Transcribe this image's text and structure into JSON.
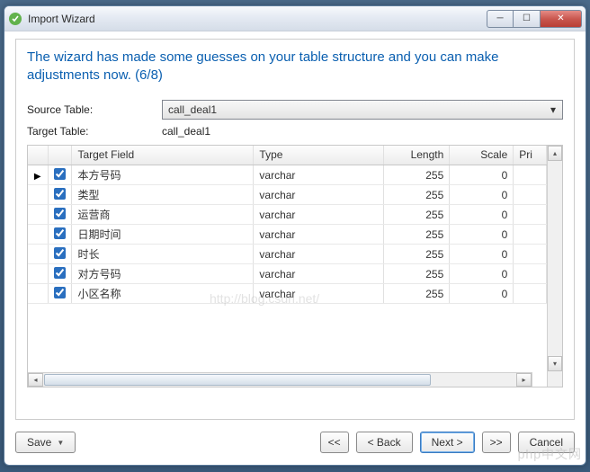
{
  "window": {
    "title": "Import Wizard"
  },
  "heading": "The wizard has made some guesses on your table structure and you can make adjustments now. (6/8)",
  "form": {
    "source_label": "Source Table:",
    "source_value": "call_deal1",
    "target_label": "Target Table:",
    "target_value": "call_deal1"
  },
  "grid": {
    "headers": {
      "field": "Target Field",
      "type": "Type",
      "length": "Length",
      "scale": "Scale",
      "primary": "Pri"
    },
    "rows": [
      {
        "current": true,
        "checked": true,
        "field": "本方号码",
        "type": "varchar",
        "length": "255",
        "scale": "0"
      },
      {
        "current": false,
        "checked": true,
        "field": "类型",
        "type": "varchar",
        "length": "255",
        "scale": "0"
      },
      {
        "current": false,
        "checked": true,
        "field": "运营商",
        "type": "varchar",
        "length": "255",
        "scale": "0"
      },
      {
        "current": false,
        "checked": true,
        "field": "日期时间",
        "type": "varchar",
        "length": "255",
        "scale": "0"
      },
      {
        "current": false,
        "checked": true,
        "field": "时长",
        "type": "varchar",
        "length": "255",
        "scale": "0"
      },
      {
        "current": false,
        "checked": true,
        "field": "对方号码",
        "type": "varchar",
        "length": "255",
        "scale": "0"
      },
      {
        "current": false,
        "checked": true,
        "field": "小区名称",
        "type": "varchar",
        "length": "255",
        "scale": "0"
      }
    ]
  },
  "footer": {
    "save": "Save",
    "first": "<<",
    "back": "< Back",
    "next": "Next >",
    "last": ">>",
    "cancel": "Cancel"
  },
  "watermark_bottom": "php中文网",
  "watermark_blur": "http://blog.csdn.net/"
}
